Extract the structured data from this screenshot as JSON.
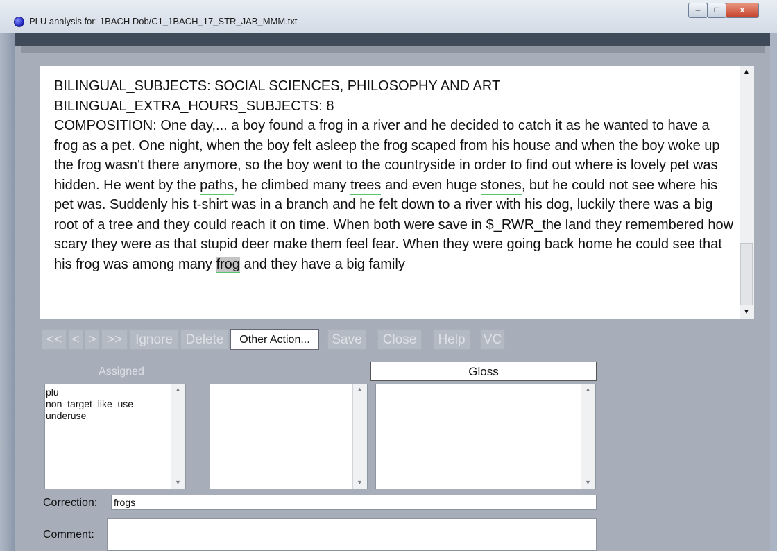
{
  "window": {
    "title": "PLU analysis for: 1BACH Dob/C1_1BACH_17_STR_JAB_MMM.txt",
    "min_glyph": "–",
    "max_glyph": "□",
    "close_glyph": "x"
  },
  "text": {
    "line1": "BILINGUAL_SUBJECTS: SOCIAL SCIENCES, PHILOSOPHY AND ART",
    "line2": "BILINGUAL_EXTRA_HOURS_SUBJECTS: 8",
    "p1": "COMPOSITION: One day,... a boy found a frog in a river and he decided to catch it as he wanted to have a frog as a pet. One night, when the boy felt asleep the frog scaped from his house and when the boy woke up the frog wasn't there anymore, so the boy went to the countryside in order to find out where is lovely pet was hidden. He went by the ",
    "w_paths": "paths",
    "p2": ", he climbed many ",
    "w_trees": "trees",
    "p3": " and even huge ",
    "w_stones": "stones",
    "p4": ", but he could not see where his pet was. Suddenly his t-shirt was in a branch and he felt down to a river with his dog, luckily there was a big root of a tree and they could reach it on time. When both were save in $_RWR_the land they remembered how scary they were as that stupid deer make them feel fear. When they were going back home he could see that his frog was among many ",
    "w_frog": "frog",
    "p5": " and they have a big family"
  },
  "toolbar": {
    "first": "<<",
    "prev": "<",
    "next": ">",
    "last": ">>",
    "ignore": "Ignore",
    "delete": "Delete",
    "other": "Other Action...",
    "save": "Save",
    "close": "Close",
    "help": "Help",
    "vc": "VC"
  },
  "lists": {
    "assigned_label": "Assigned",
    "gloss_label": "Gloss",
    "assigned_items": [
      "plu",
      "non_target_like_use",
      "underuse"
    ]
  },
  "form": {
    "correction_label": "Correction:",
    "correction_value": "frogs",
    "comment_label": "Comment:"
  }
}
